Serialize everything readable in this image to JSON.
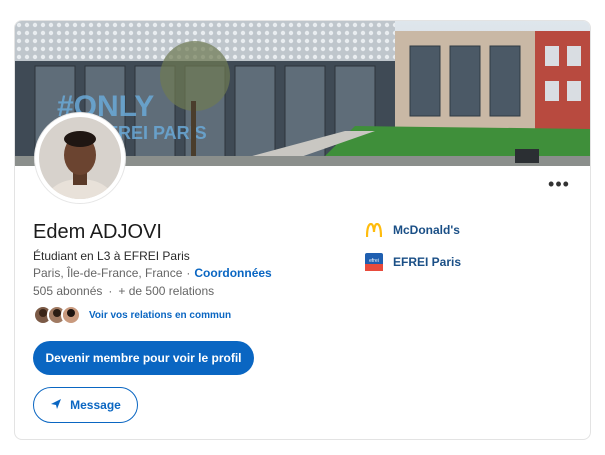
{
  "profile": {
    "name": "Edem ADJOVI",
    "headline": "Étudiant en L3 à EFREI Paris",
    "location": "Paris, Île-de-France, France",
    "contact_link": "Coordonnées",
    "followers": "505 abonnés",
    "connections": "+ de 500 relations",
    "mutual_link": "Voir vos relations en commun"
  },
  "actions": {
    "join_label": "Devenir membre pour voir le profil",
    "message_label": "Message",
    "more_label": "•••"
  },
  "experience": [
    {
      "label": "McDonald's",
      "icon": "mcdonalds-logo"
    },
    {
      "label": "EFREI Paris",
      "icon": "efrei-logo",
      "icon_text": "efrei"
    }
  ],
  "colors": {
    "brand_blue": "#0a66c2",
    "link_blue": "#1a4f86",
    "mcdonalds_yellow": "#ffbc0d",
    "efrei_red": "#e84b3c"
  }
}
